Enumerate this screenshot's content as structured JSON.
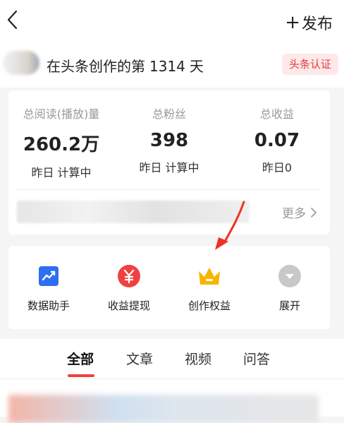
{
  "header": {
    "publish_plus": "+",
    "publish_label": "发布"
  },
  "profile": {
    "text_prefix": "在头条创作的第",
    "days": "1314",
    "text_suffix": "天",
    "badge": "头条认证"
  },
  "stats": [
    {
      "label": "总阅读(播放)量",
      "value": "260.2万",
      "sub": "昨日 计算中"
    },
    {
      "label": "总粉丝",
      "value": "398",
      "sub": "昨日 计算中"
    },
    {
      "label": "总收益",
      "value": "0.07",
      "sub": "昨日0"
    }
  ],
  "more_label": "更多",
  "tools": [
    {
      "label": "数据助手",
      "icon": "chart-icon",
      "color": "#2e6ff2"
    },
    {
      "label": "收益提现",
      "icon": "yen-icon",
      "color": "#f04142"
    },
    {
      "label": "创作权益",
      "icon": "crown-icon",
      "color": "#f7b500"
    },
    {
      "label": "展开",
      "icon": "chevron-down-icon",
      "color": "#c8c8c8"
    }
  ],
  "tabs": [
    "全部",
    "文章",
    "视频",
    "问答"
  ],
  "active_tab": "全部",
  "colors": {
    "accent": "#f04142",
    "badge_bg": "#fde9e9",
    "muted": "#999999"
  }
}
